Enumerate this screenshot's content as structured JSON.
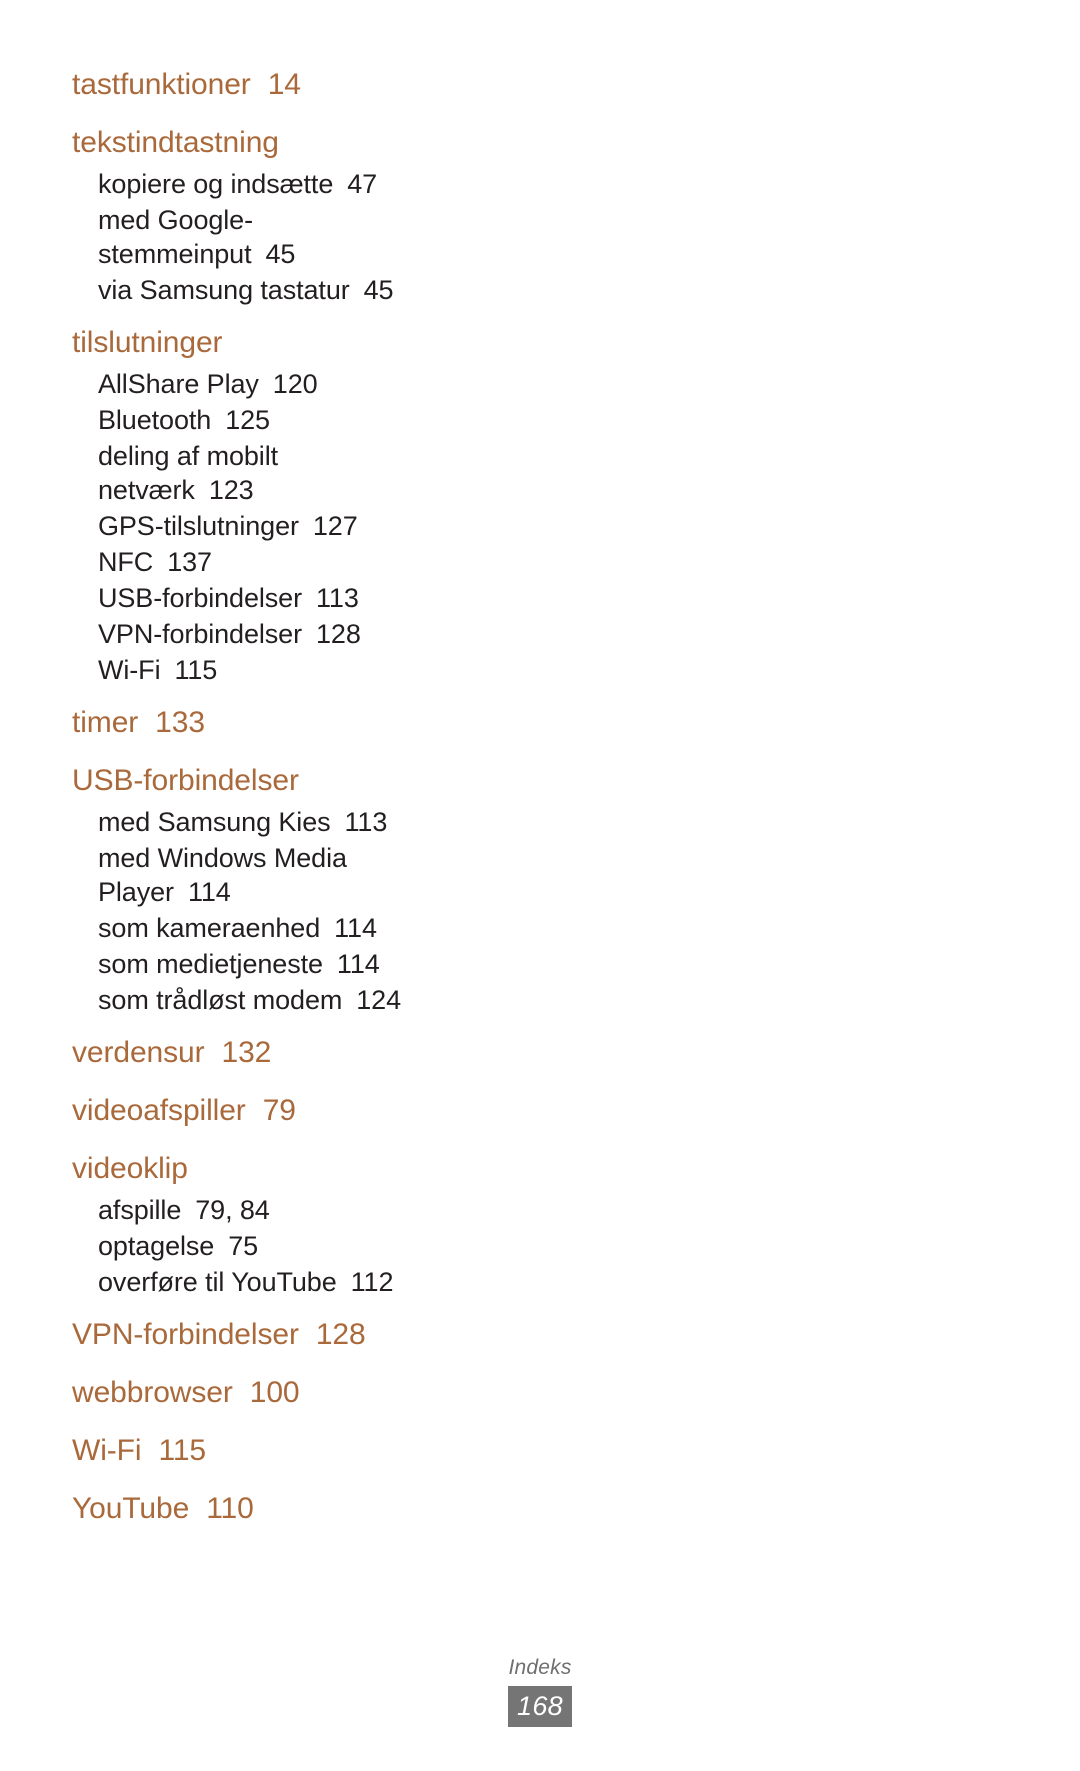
{
  "document": {
    "type": "index",
    "language": "da",
    "accent_color": "#a9693b",
    "text_color": "#231f20",
    "background_color": "#ffffff"
  },
  "index": {
    "entries": [
      {
        "level": "main",
        "label": "tastfunktioner",
        "page": "14"
      },
      {
        "level": "main",
        "label": "tekstindtastning",
        "page": ""
      },
      {
        "level": "sub",
        "label": "kopiere og indsætte",
        "page": "47"
      },
      {
        "level": "sub",
        "label": "med Google-",
        "page": ""
      },
      {
        "level": "sub-cont",
        "label": "stemmeinput",
        "page": "45"
      },
      {
        "level": "sub",
        "label": "via Samsung tastatur",
        "page": "45"
      },
      {
        "level": "main",
        "label": "tilslutninger",
        "page": ""
      },
      {
        "level": "sub",
        "label": "AllShare Play",
        "page": "120"
      },
      {
        "level": "sub",
        "label": "Bluetooth",
        "page": "125"
      },
      {
        "level": "sub",
        "label": "deling af mobilt",
        "page": ""
      },
      {
        "level": "sub-cont",
        "label": "netværk",
        "page": "123"
      },
      {
        "level": "sub",
        "label": "GPS-tilslutninger",
        "page": "127"
      },
      {
        "level": "sub",
        "label": "NFC",
        "page": "137"
      },
      {
        "level": "sub",
        "label": "USB-forbindelser",
        "page": "113"
      },
      {
        "level": "sub",
        "label": "VPN-forbindelser",
        "page": "128"
      },
      {
        "level": "sub",
        "label": "Wi-Fi",
        "page": "115"
      },
      {
        "level": "main",
        "label": "timer",
        "page": "133"
      },
      {
        "level": "main",
        "label": "USB-forbindelser",
        "page": ""
      },
      {
        "level": "sub",
        "label": "med Samsung Kies",
        "page": "113"
      },
      {
        "level": "sub",
        "label": "med Windows Media",
        "page": ""
      },
      {
        "level": "sub-cont",
        "label": "Player",
        "page": "114"
      },
      {
        "level": "sub",
        "label": "som kameraenhed",
        "page": "114"
      },
      {
        "level": "sub",
        "label": "som medietjeneste",
        "page": "114"
      },
      {
        "level": "sub",
        "label": "som trådløst modem",
        "page": "124"
      },
      {
        "level": "main",
        "label": "verdensur",
        "page": "132"
      },
      {
        "level": "main",
        "label": "videoafspiller",
        "page": "79"
      },
      {
        "level": "main",
        "label": "videoklip",
        "page": ""
      },
      {
        "level": "sub",
        "label": "afspille",
        "page": "79, 84"
      },
      {
        "level": "sub",
        "label": "optagelse",
        "page": "75"
      },
      {
        "level": "sub",
        "label": "overføre til YouTube",
        "page": "112"
      },
      {
        "level": "main",
        "label": "VPN-forbindelser",
        "page": "128"
      },
      {
        "level": "main",
        "label": "webbrowser",
        "page": "100"
      },
      {
        "level": "main",
        "label": "Wi-Fi",
        "page": "115"
      },
      {
        "level": "main",
        "label": "YouTube",
        "page": "110"
      }
    ]
  },
  "footer": {
    "section_label": "Indeks",
    "page_number": "168",
    "badge_color": "#757575",
    "label_color": "#6f6f6f"
  }
}
